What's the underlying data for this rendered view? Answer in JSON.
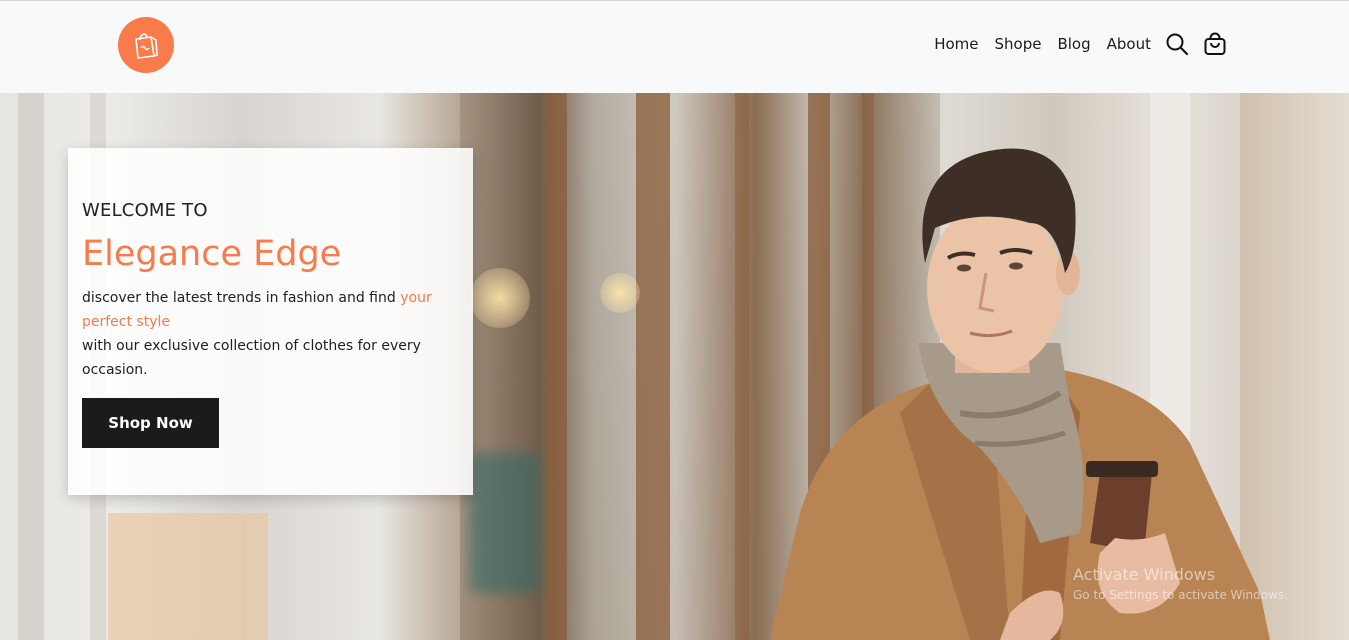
{
  "brand_color": "#f97b4a",
  "header": {
    "logo_icon": "shopping-bag-icon",
    "nav": [
      {
        "label": "Home"
      },
      {
        "label": "Shope"
      },
      {
        "label": "Blog"
      },
      {
        "label": "About"
      }
    ],
    "search_icon": "search-icon",
    "cart_icon": "cart-bag-icon"
  },
  "hero": {
    "welcome": "WELCOME TO",
    "brand_name": "Elegance Edge",
    "desc_part1": "discover the latest trends in fashion and find ",
    "desc_accent": "your perfect style",
    "desc_part2": "with our exclusive collection of clothes for every occasion.",
    "cta_label": "Shop Now"
  },
  "watermark": {
    "title": "Activate Windows",
    "subtitle": "Go to Settings to activate Windows."
  }
}
